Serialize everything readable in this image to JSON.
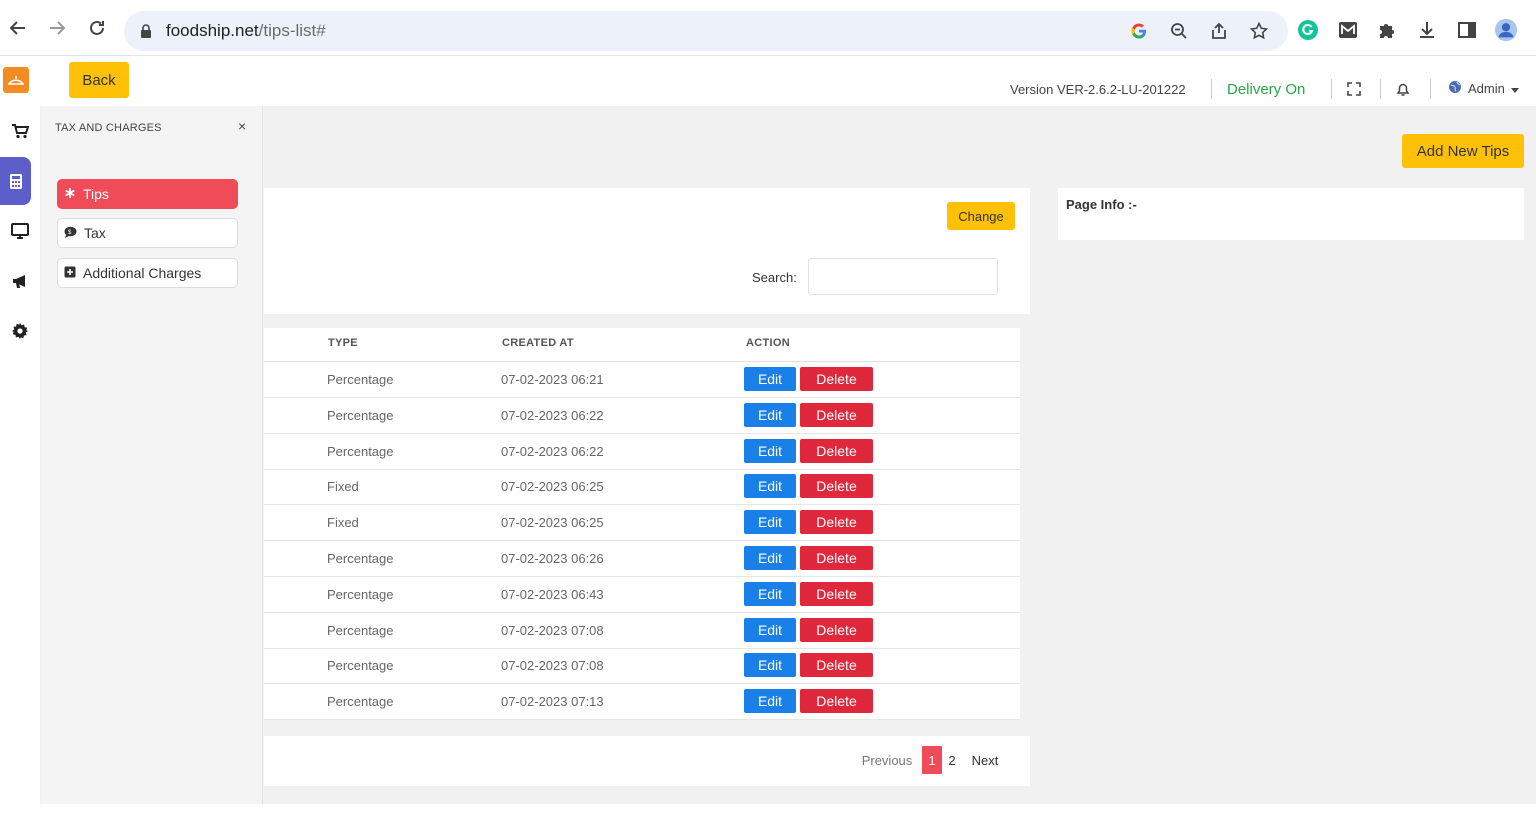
{
  "browser": {
    "url_host": "foodship.net",
    "url_path": "/tips-list#"
  },
  "header": {
    "back_label": "Back",
    "version": "Version VER-2.6.2-LU-201222",
    "delivery_status": "Delivery On",
    "user": "Admin"
  },
  "side_panel": {
    "title": "TAX AND CHARGES",
    "close": "×",
    "items": [
      {
        "label": "Tips",
        "active": true
      },
      {
        "label": "Tax",
        "active": false
      },
      {
        "label": "Additional Charges",
        "active": false
      }
    ]
  },
  "page": {
    "add_button": "Add New Tips",
    "change_button": "Change",
    "search_label": "Search:",
    "search_value": "",
    "info_label": "Page Info :-"
  },
  "table": {
    "headers": [
      "TYPE",
      "CREATED AT",
      "ACTION"
    ],
    "edit_label": "Edit",
    "delete_label": "Delete",
    "rows": [
      {
        "type": "Percentage",
        "created_at": "07-02-2023 06:21"
      },
      {
        "type": "Percentage",
        "created_at": "07-02-2023 06:22"
      },
      {
        "type": "Percentage",
        "created_at": "07-02-2023 06:22"
      },
      {
        "type": "Fixed",
        "created_at": "07-02-2023 06:25"
      },
      {
        "type": "Fixed",
        "created_at": "07-02-2023 06:25"
      },
      {
        "type": "Percentage",
        "created_at": "07-02-2023 06:26"
      },
      {
        "type": "Percentage",
        "created_at": "07-02-2023 06:43"
      },
      {
        "type": "Percentage",
        "created_at": "07-02-2023 07:08"
      },
      {
        "type": "Percentage",
        "created_at": "07-02-2023 07:08"
      },
      {
        "type": "Percentage",
        "created_at": "07-02-2023 07:13"
      }
    ]
  },
  "pagination": {
    "previous": "Previous",
    "pages": [
      "1",
      "2"
    ],
    "current": "1",
    "next": "Next"
  },
  "colors": {
    "accent_yellow": "#ffc107",
    "active_red": "#ef4b58",
    "edit_blue": "#1a7fe6",
    "delete_red": "#e0283d",
    "rail_active": "#5c5fc9",
    "delivery_green": "#28a745"
  },
  "icons": {
    "rail": [
      "cart-icon",
      "calculator-icon",
      "monitor-icon",
      "megaphone-icon",
      "gear-icon"
    ],
    "browser": [
      "back-arrow-icon",
      "forward-arrow-icon",
      "reload-icon",
      "lock-icon",
      "google-icon",
      "zoom-icon",
      "share-icon",
      "star-icon",
      "grammarly-icon",
      "gmail-icon",
      "puzzle-icon",
      "download-icon",
      "side-panel-icon",
      "profile-icon"
    ],
    "header": [
      "fullscreen-icon",
      "bell-icon",
      "globe-icon",
      "caret-down-icon"
    ]
  }
}
